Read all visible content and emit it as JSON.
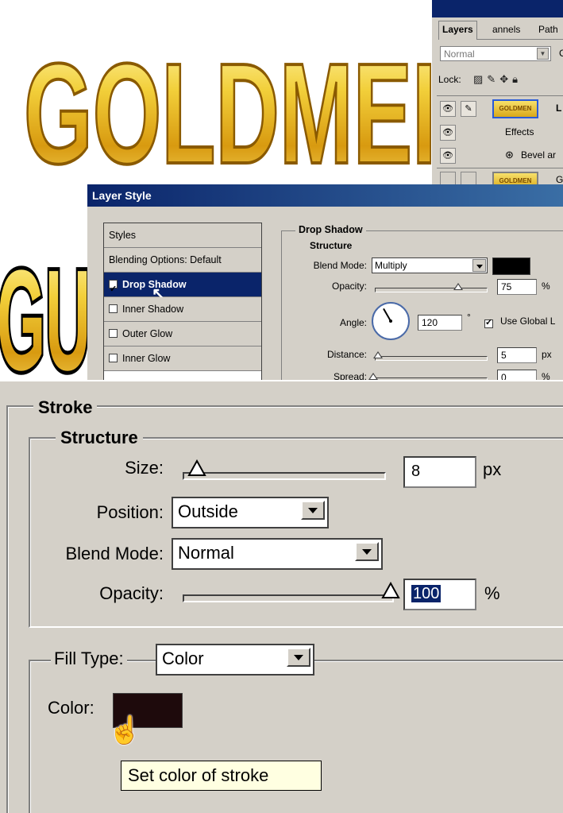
{
  "artwork": {
    "headline_top": "GOLDMEI",
    "headline_bottom": "GU"
  },
  "layers_palette": {
    "tabs": [
      "Layers",
      "annels",
      "Path"
    ],
    "blend_mode": "Normal",
    "lock_label": "Lock:",
    "opacity_fragment": "C",
    "rows": [
      {
        "label": "L",
        "thumb_text": "GOLDMEN"
      },
      {
        "label": "Effects"
      },
      {
        "label": "Bevel ar"
      },
      {
        "label": "G",
        "thumb_text": "GOLDMEN"
      }
    ]
  },
  "layer_style": {
    "title": "Layer Style",
    "styles_header": "Styles",
    "items": [
      {
        "label": "Blending Options: Default",
        "checked": null
      },
      {
        "label": "Drop Shadow",
        "checked": true,
        "selected": true
      },
      {
        "label": "Inner Shadow",
        "checked": false
      },
      {
        "label": "Outer Glow",
        "checked": false
      },
      {
        "label": "Inner Glow",
        "checked": false
      }
    ],
    "drop_shadow": {
      "section": "Drop Shadow",
      "structure": "Structure",
      "blend_mode_label": "Blend Mode:",
      "blend_mode": "Multiply",
      "shadow_color": "#000000",
      "opacity_label": "Opacity:",
      "opacity": "75",
      "opacity_unit": "%",
      "opacity_level": 0.75,
      "angle_label": "Angle:",
      "angle": "120",
      "angle_unit": "°",
      "use_global_label": "Use Global L",
      "use_global_checked": true,
      "distance_label": "Distance:",
      "distance": "5",
      "distance_unit": "px",
      "spread_label": "Spread:",
      "spread": "0",
      "spread_unit": "%"
    }
  },
  "stroke_panel": {
    "section": "Stroke",
    "structure": "Structure",
    "size_label": "Size:",
    "size": "8",
    "size_unit": "px",
    "position_label": "Position:",
    "position": "Outside",
    "blend_mode_label": "Blend Mode:",
    "blend_mode": "Normal",
    "opacity_label": "Opacity:",
    "opacity": "100",
    "opacity_unit": "%",
    "opacity_level": 1.0,
    "fill_type_label": "Fill Type:",
    "fill_type": "Color",
    "color_label": "Color:",
    "color": "#1e0a0c",
    "tooltip": "Set color of stroke"
  }
}
